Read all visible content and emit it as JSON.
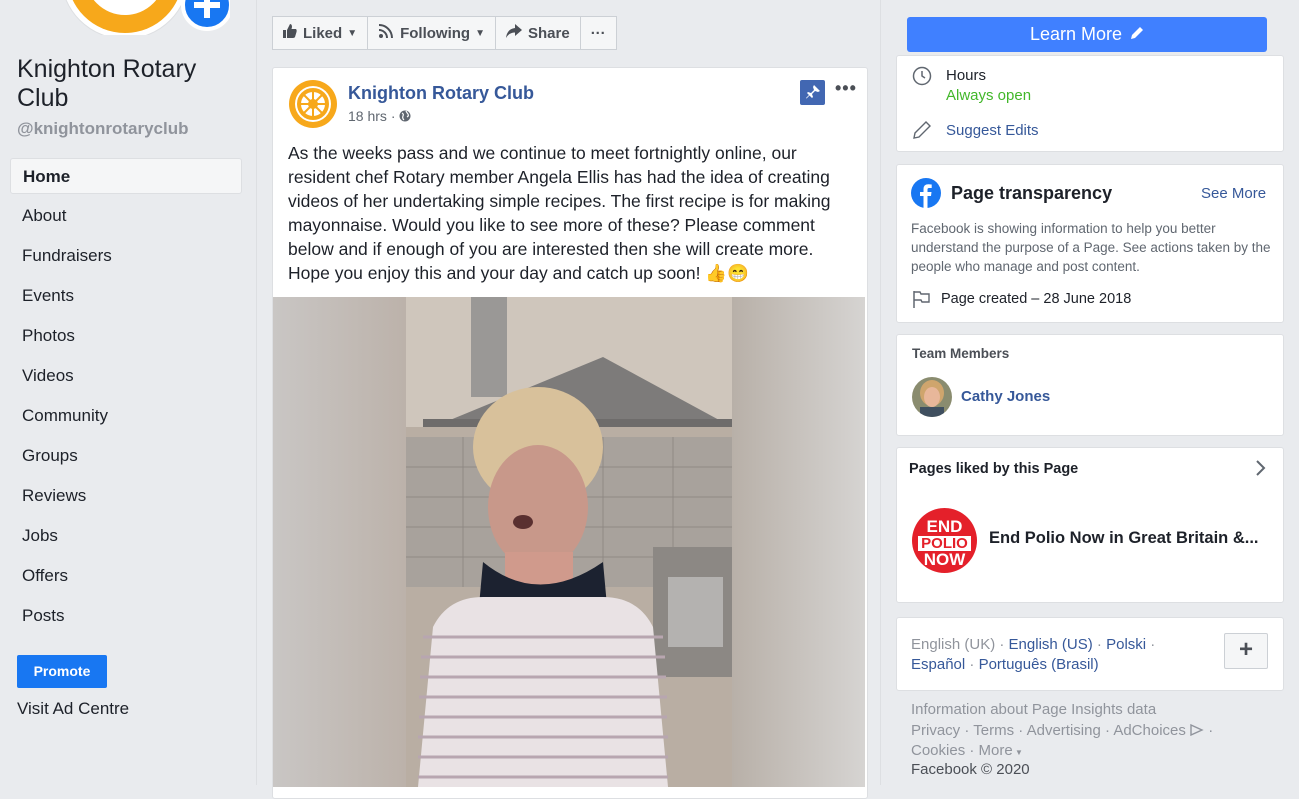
{
  "page": {
    "name": "Knighton Rotary Club",
    "handle": "@knightonrotaryclub"
  },
  "nav": [
    {
      "label": "Home",
      "active": true
    },
    {
      "label": "About"
    },
    {
      "label": "Fundraisers"
    },
    {
      "label": "Events"
    },
    {
      "label": "Photos"
    },
    {
      "label": "Videos"
    },
    {
      "label": "Community"
    },
    {
      "label": "Groups"
    },
    {
      "label": "Reviews"
    },
    {
      "label": "Jobs"
    },
    {
      "label": "Offers"
    },
    {
      "label": "Posts"
    }
  ],
  "promote_label": "Promote",
  "ad_centre_label": "Visit Ad Centre",
  "actions": {
    "liked": "Liked",
    "following": "Following",
    "share": "Share",
    "more": "···",
    "learn_more": "Learn More"
  },
  "post": {
    "author": "Knighton Rotary Club",
    "time": "18 hrs",
    "more": "•••",
    "text": "As the weeks pass and we continue to meet fortnightly online, our resident chef Rotary member Angela Ellis has had the idea of creating videos of her undertaking simple recipes. The first recipe is for making mayonnaise. Would you like to see more of these? Please comment below and if enough of you are interested then she will create more. Hope you enjoy this and your day and catch up soon! 👍😁"
  },
  "about": {
    "hours_label": "Hours",
    "hours_value": "Always open",
    "suggest_edits": "Suggest Edits"
  },
  "transparency": {
    "title": "Page transparency",
    "see_more": "See More",
    "description": "Facebook is showing information to help you better understand the purpose of a Page. See actions taken by the people who manage and post content.",
    "created": "Page created – 28 June 2018"
  },
  "team": {
    "title": "Team Members",
    "member": "Cathy Jones"
  },
  "liked_pages": {
    "title": "Pages liked by this Page",
    "page_name": "End Polio Now in Great Britain &...",
    "logo_text": [
      "END",
      "POLIO",
      "NOW"
    ]
  },
  "languages": {
    "current": "English (UK)",
    "others": [
      "English (US)",
      "Polski",
      "Español",
      "Português (Brasil)"
    ],
    "add": "+"
  },
  "footer": {
    "insights": "Information about Page Insights data",
    "links": [
      "Privacy",
      "Terms",
      "Advertising",
      "AdChoices",
      "Cookies",
      "More"
    ],
    "copyright": "Facebook © 2020"
  },
  "colors": {
    "fb_blue": "#1877f2",
    "link": "#365899",
    "learn_more": "#4080ff",
    "open_green": "#42b72a",
    "polio_red": "#e4202a",
    "rotary_gold": "#f7a81b"
  }
}
